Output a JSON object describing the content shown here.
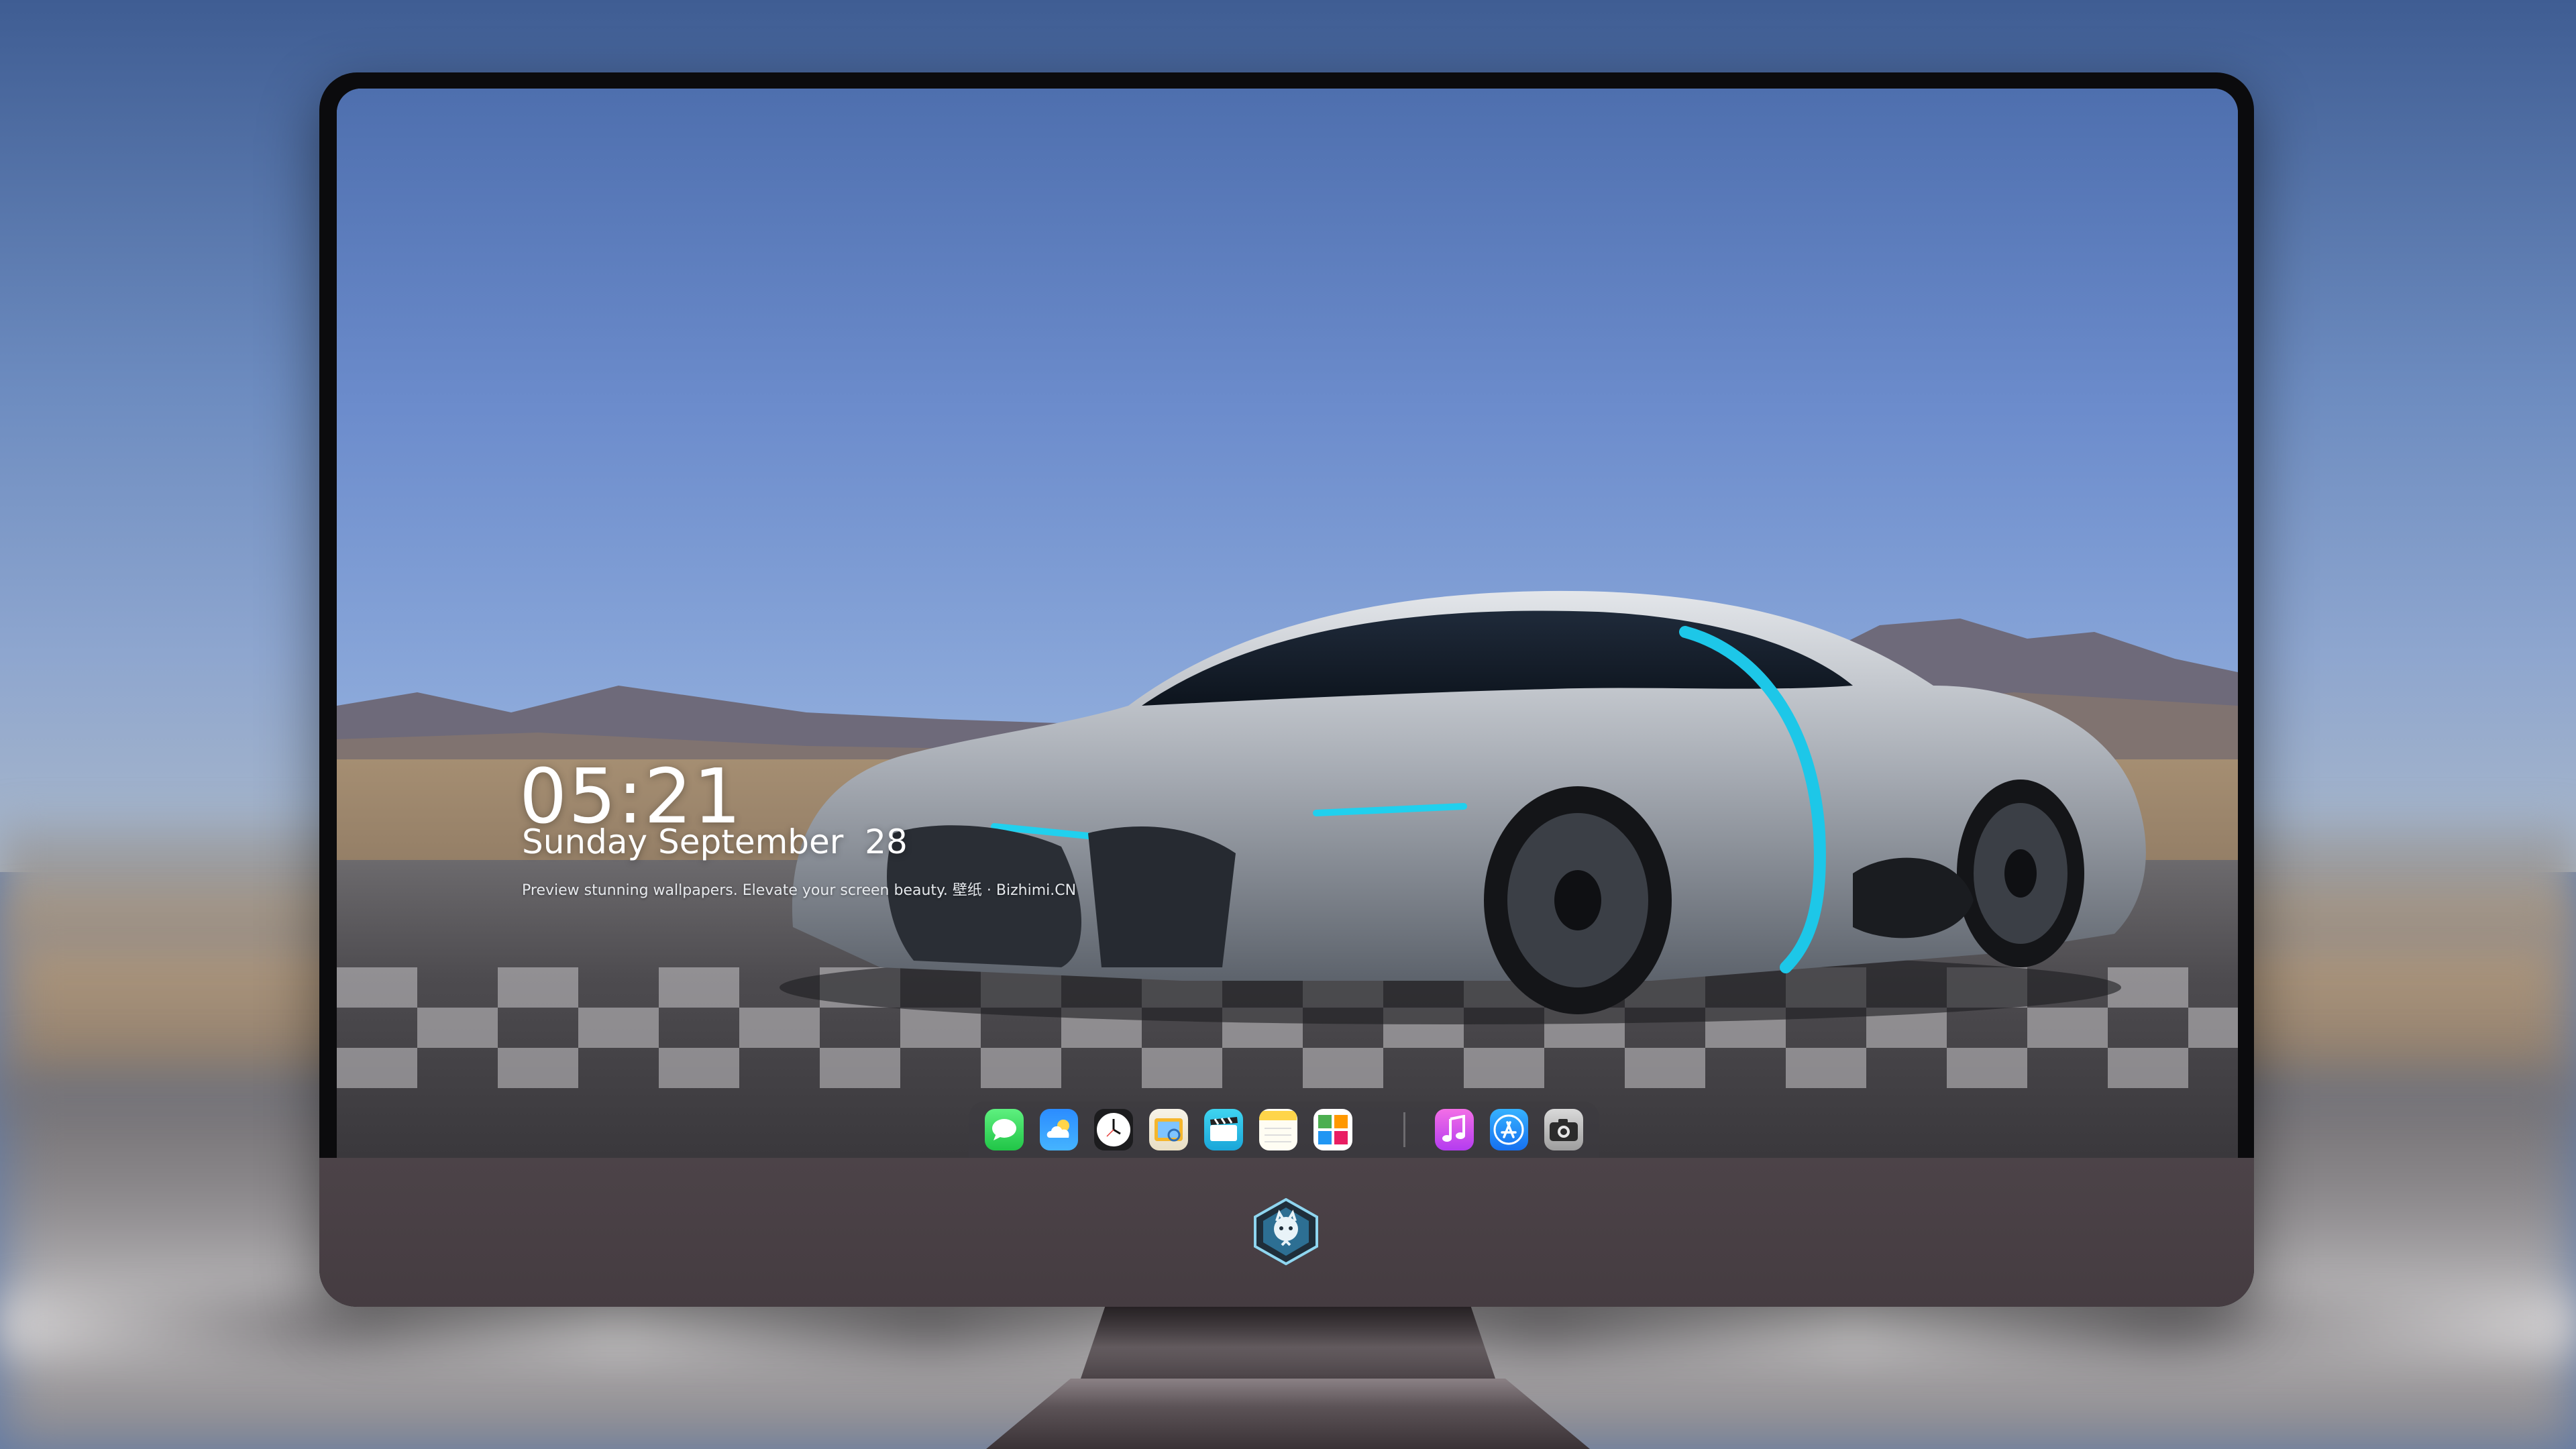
{
  "lock_screen": {
    "time": "05:21",
    "date": "Sunday September  28",
    "caption": "Preview stunning wallpapers. Elevate your screen beauty. 壁纸 · Bizhimi.CN"
  },
  "dock": {
    "apps_left": [
      {
        "name": "messages",
        "icon": "message-bubble-icon",
        "color": "#2fd158"
      },
      {
        "name": "weather",
        "icon": "cloud-icon",
        "color": "#1e90ff"
      },
      {
        "name": "clock",
        "icon": "clock-icon",
        "color": "#ffffff"
      },
      {
        "name": "preview",
        "icon": "photo-viewer-icon",
        "color": "#f5b62c"
      },
      {
        "name": "clips",
        "icon": "clapperboard-icon",
        "color": "#2ec5e8"
      },
      {
        "name": "notes",
        "icon": "notes-icon",
        "color": "#ffd54a"
      },
      {
        "name": "photos-collage",
        "icon": "collage-icon",
        "color": "#ffffff"
      }
    ],
    "apps_right": [
      {
        "name": "music",
        "icon": "music-note-icon",
        "color": "#e040fb"
      },
      {
        "name": "app-store",
        "icon": "app-store-icon",
        "color": "#1d8cf8"
      },
      {
        "name": "camera",
        "icon": "camera-icon",
        "color": "#9e9e9e"
      }
    ]
  },
  "colors": {
    "chin": "#4a4146",
    "bezel": "#0b0b0d",
    "text": "#ffffff"
  }
}
